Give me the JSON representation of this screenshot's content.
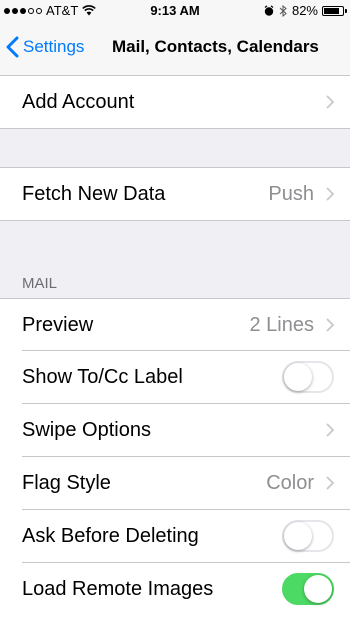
{
  "status_bar": {
    "carrier": "AT&T",
    "time": "9:13 AM",
    "battery": "82%",
    "battery_level": 0.82,
    "signal_bars": 3,
    "icons": [
      "wifi-icon",
      "alarm-icon",
      "bluetooth-icon",
      "battery-icon"
    ]
  },
  "nav": {
    "back_label": "Settings",
    "title": "Mail, Contacts, Calendars"
  },
  "rows": {
    "add_account": {
      "label": "Add Account"
    },
    "fetch_new_data": {
      "label": "Fetch New Data",
      "value": "Push"
    },
    "mail_header": "MAIL",
    "preview": {
      "label": "Preview",
      "value": "2 Lines"
    },
    "show_to_cc": {
      "label": "Show To/Cc Label",
      "on": false
    },
    "swipe_options": {
      "label": "Swipe Options"
    },
    "flag_style": {
      "label": "Flag Style",
      "value": "Color"
    },
    "ask_before_deleting": {
      "label": "Ask Before Deleting",
      "on": false
    },
    "load_remote_images": {
      "label": "Load Remote Images",
      "on": true
    }
  },
  "colors": {
    "accent": "#007aff",
    "toggle_on": "#4cd964",
    "background": "#efeff4"
  }
}
